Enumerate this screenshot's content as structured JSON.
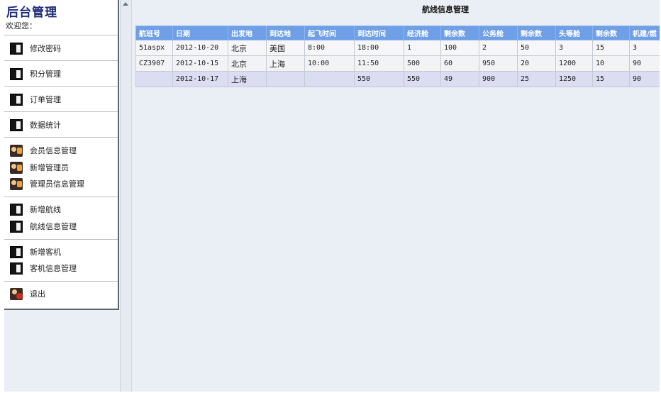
{
  "sidebar": {
    "title": "后台管理",
    "welcome": "欢迎您：",
    "items": [
      {
        "label": "修改密码",
        "icon": "book-icon"
      },
      {
        "label": "积分管理",
        "icon": "book-icon"
      },
      {
        "label": "订单管理",
        "icon": "book-icon"
      },
      {
        "label": "数据统计",
        "icon": "book-icon"
      },
      {
        "label": "会员信息管理",
        "icon": "user-icon"
      },
      {
        "label": "新增管理员",
        "icon": "user-icon"
      },
      {
        "label": "管理员信息管理",
        "icon": "user-icon"
      },
      {
        "label": "新增航线",
        "icon": "book-icon"
      },
      {
        "label": "航线信息管理",
        "icon": "book-icon"
      },
      {
        "label": "新增客机",
        "icon": "book-icon"
      },
      {
        "label": "客机信息管理",
        "icon": "book-icon"
      },
      {
        "label": "退出",
        "icon": "exit-icon"
      }
    ]
  },
  "main": {
    "title": "航线信息管理",
    "columns": [
      "航班号",
      "日期",
      "出发地",
      "到达地",
      "起飞时间",
      "到达时间",
      "经济舱",
      "剩余数",
      "公务舱",
      "剩余数",
      "头等舱",
      "剩余数",
      "机建/燃"
    ],
    "rows": [
      [
        "51aspx",
        "2012-10-20",
        "北京",
        "美国",
        "8:00",
        "18:00",
        "1",
        "100",
        "2",
        "50",
        "3",
        "15",
        "3"
      ],
      [
        "CZ3907",
        "2012-10-15",
        "北京",
        "上海",
        "10:00",
        "11:50",
        "500",
        "60",
        "950",
        "20",
        "1200",
        "10",
        "90"
      ],
      [
        "",
        "2012-10-17",
        "上海",
        "",
        "",
        "550",
        "550",
        "49",
        "900",
        "25",
        "1250",
        "15",
        "90"
      ]
    ]
  },
  "colors": {
    "header_bg": "#6f9fe6",
    "page_bg": "#eaeff6",
    "title_color": "#1c2a7a"
  }
}
